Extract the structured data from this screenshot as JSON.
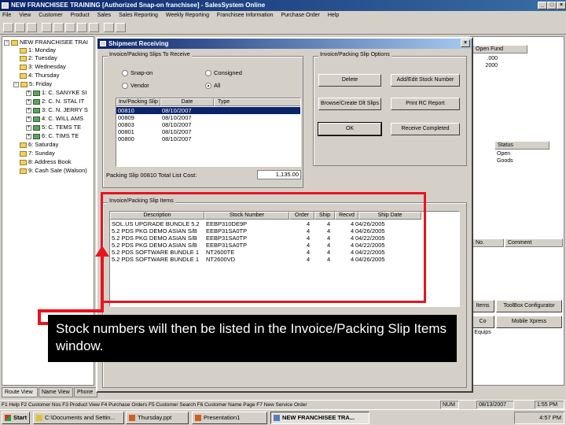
{
  "app": {
    "title": "NEW FRANCHISEE TRAINING [Authorized Snap-on franchisee] - SalesSystem Online",
    "menu": [
      "File",
      "View",
      "Customer",
      "Product",
      "Sales",
      "Sales Reporting",
      "Weekly Reporting",
      "Franchisee Information",
      "Purchase Order",
      "Help"
    ]
  },
  "tree": {
    "root": "NEW FRANCHISEE TRAI",
    "items": [
      "1: Monday",
      "2: Tuesday",
      "3: Wednesday",
      "4: Thursday",
      "5: Friday",
      "1: C. SANYKE SI",
      "2: C. N. STAL IT",
      "3: C. N. JERRY S",
      "4: C. WILL AMS",
      "5: C. TEMS TE",
      "6: C. TIMS TE",
      "6: Saturday",
      "7: Sunday",
      "8: Address Book",
      "9: Cash Sale (Walson)"
    ]
  },
  "tabs": [
    "Route View",
    "Name View",
    "Phone"
  ],
  "right_panel": {
    "col1": "Open Fund",
    "values": [
      ".000",
      "2000"
    ],
    "status_header": "Status",
    "status_values": [
      "Open",
      "Goods"
    ],
    "lower_col1": "No.",
    "lower_col2": "Comment",
    "buttons": [
      "Items",
      "ToolBox Configurator",
      "Co Equips",
      "Mobile Xpress"
    ]
  },
  "dialog": {
    "title": "Shipment Receiving",
    "group_left": "Invoice/Packing Slips To Receive",
    "radios": [
      {
        "label": "Snap-on",
        "checked": false
      },
      {
        "label": "Consigned",
        "checked": false
      },
      {
        "label": "Vendor",
        "checked": false
      },
      {
        "label": "All",
        "checked": true
      }
    ],
    "slips_headers": [
      "Inv/Packing Slip",
      "Date",
      "Type"
    ],
    "slips": [
      {
        "slip": "00810",
        "date": "08/10/2007",
        "type": ""
      },
      {
        "slip": "00809",
        "date": "08/10/2007",
        "type": ""
      },
      {
        "slip": "00803",
        "date": "08/10/2007",
        "type": ""
      },
      {
        "slip": "00801",
        "date": "08/10/2007",
        "type": ""
      },
      {
        "slip": "00800",
        "date": "08/10/2007",
        "type": ""
      }
    ],
    "total_label": "Packing Slip 00810 Total List Cost:",
    "total_value": "1,135.00",
    "group_right": "Invoice/Packing Slip Options",
    "buttons": [
      "Delete",
      "Add/Edit Stock Number",
      "Browse/Create Dlt Slips",
      "Print RC Report",
      "OK",
      "Receive Completed"
    ],
    "items_group": "Invoice/Packing Slip Items",
    "items_headers": [
      "Description",
      "Stock Number",
      "Order",
      "Ship",
      "Recvd",
      "Ship Date"
    ],
    "items": [
      {
        "desc": "SOL.US UPGRADE BUNDLE 5.2",
        "stock": "EEBP310DE9P",
        "order": "4",
        "ship": "4",
        "recvd": "4",
        "date": "04/26/2005"
      },
      {
        "desc": "5.2 PDS PKG DEMO ASIAN S/B",
        "stock": "EEBP31SA0TP",
        "order": "4",
        "ship": "4",
        "recvd": "4",
        "date": "04/26/2005"
      },
      {
        "desc": "5.2 PDS PKG DEMO ASIAN S/B",
        "stock": "EEBP31SA0TP",
        "order": "4",
        "ship": "4",
        "recvd": "4",
        "date": "04/22/2005"
      },
      {
        "desc": "5.2 PDS PKG DEMO ASIAN S/B",
        "stock": "EEBP31SA0TP",
        "order": "4",
        "ship": "4",
        "recvd": "4",
        "date": "04/22/2005"
      },
      {
        "desc": "5.2 PDS SOFTWARE BUNDLE 1",
        "stock": "NT2600TE",
        "order": "4",
        "ship": "4",
        "recvd": "4",
        "date": "04/22/2005"
      },
      {
        "desc": "5.2 PDS SOFTWARE BUNDLE 1",
        "stock": "NT2600VD",
        "order": "4",
        "ship": "4",
        "recvd": "4",
        "date": "04/26/2005"
      }
    ]
  },
  "callout": "Stock numbers will then be listed in the Invoice/Packing Slip Items window.",
  "status_bar": {
    "hint": "F1 Help  F2 Customer Nos  F3 Product View  F4 Purchase Orders  F5 Customer Search  F6 Customer Name Page  F7 New Service Order",
    "num": "NUM",
    "date": "08/13/2007",
    "time": "1:55 PM"
  },
  "taskbar": {
    "start": "Start",
    "items": [
      "C:\\Documents and Settin...",
      "Thursday.ppt",
      "Presentation1",
      "NEW FRANCHISEE TRA..."
    ],
    "clock": "4:57 PM"
  },
  "colors": {
    "accent": "#e8141e",
    "title_bar": "#0a246a",
    "selection": "#0a246a"
  }
}
